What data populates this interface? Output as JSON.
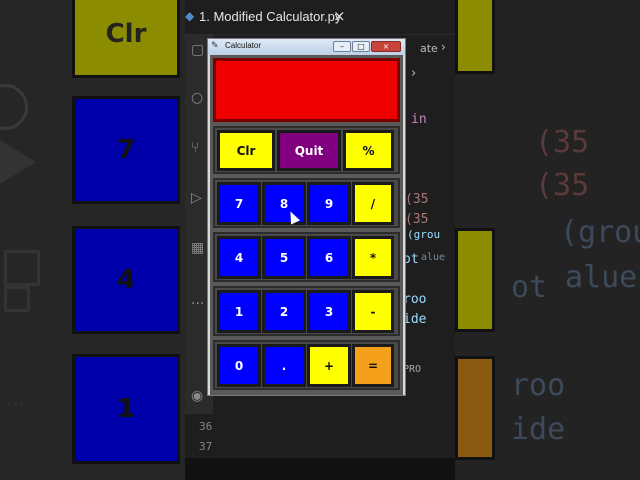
{
  "editor": {
    "tab_title": "1. Modified Calculator.py",
    "tab_close": "×",
    "breadcrumb_fragment": "ate",
    "line_numbers": [
      "36",
      "37"
    ],
    "code_fragments": [
      "(35",
      "(35",
      "(grou",
      "ot",
      "alue",
      "roo",
      "ide",
      "PRO"
    ]
  },
  "background": {
    "left_keys": [
      "Clr",
      "7",
      "4",
      "1"
    ],
    "right_code": [
      "(35",
      "(35",
      "(grou",
      "alue",
      "ot",
      "roo",
      "ide"
    ]
  },
  "calculator": {
    "window_title": "Calculator",
    "window_controls": {
      "minimize": "–",
      "maximize": "□",
      "close": "×"
    },
    "display_value": "",
    "colors": {
      "display": "#ee0000",
      "yellow": "#ffff00",
      "purple": "#800080",
      "blue": "#0000ff",
      "orange": "#f5a01a"
    },
    "top_row": [
      "Clr",
      "Quit",
      "%"
    ],
    "rows": [
      [
        "7",
        "8",
        "9",
        "/"
      ],
      [
        "4",
        "5",
        "6",
        "*"
      ],
      [
        "1",
        "2",
        "3",
        "-"
      ],
      [
        "0",
        ".",
        "+",
        "="
      ]
    ]
  }
}
